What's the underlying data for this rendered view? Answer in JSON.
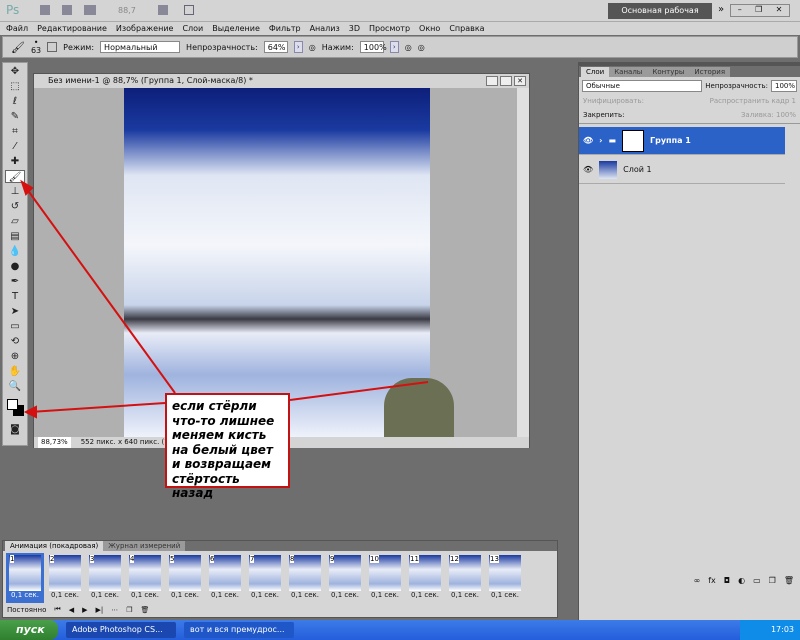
{
  "appbar": {
    "logo": "Ps",
    "zoom": "88,7",
    "workspace": "Основная рабочая среда"
  },
  "menu": [
    "Файл",
    "Редактирование",
    "Изображение",
    "Слои",
    "Выделение",
    "Фильтр",
    "Анализ",
    "3D",
    "Просмотр",
    "Окно",
    "Справка"
  ],
  "options": {
    "brush_size": "63",
    "mode_label": "Режим:",
    "mode_value": "Нормальный",
    "opacity_label": "Непрозрачность:",
    "opacity_value": "64%",
    "flow_label": "Нажим:",
    "flow_value": "100%"
  },
  "document": {
    "title": "Без имени-1 @ 88,7% (Группа 1, Слой-маска/8) *",
    "zoom": "88,73%",
    "info": "552 пикс. x 640 пикс. (72 р"
  },
  "annotation": "если стёрли что-то лишнее меняем кисть на белый цвет и возвращаем стёртость назад",
  "layers_panel": {
    "tabs": [
      "Слои",
      "Каналы",
      "Контуры",
      "История"
    ],
    "blend_mode": "Обычные",
    "opacity_label": "Непрозрачность:",
    "opacity_value": "100%",
    "unify_label": "Унифицировать:",
    "propagate_label": "Распространить кадр 1",
    "lock_label": "Закрепить:",
    "fill_label": "Заливка:",
    "fill_value": "100%",
    "layers": [
      {
        "name": "Группа 1",
        "selected": true
      },
      {
        "name": "Слой 1",
        "selected": false
      }
    ]
  },
  "animation": {
    "tabs": [
      "Анимация (покадровая)",
      "Журнал измерений"
    ],
    "frames": [
      {
        "n": "1",
        "delay": "0,1 сек."
      },
      {
        "n": "2",
        "delay": "0,1 сек."
      },
      {
        "n": "3",
        "delay": "0,1 сек."
      },
      {
        "n": "4",
        "delay": "0,1 сек."
      },
      {
        "n": "5",
        "delay": "0,1 сек."
      },
      {
        "n": "6",
        "delay": "0,1 сек."
      },
      {
        "n": "7",
        "delay": "0,1 сек."
      },
      {
        "n": "8",
        "delay": "0,1 сек."
      },
      {
        "n": "9",
        "delay": "0,1 сек."
      },
      {
        "n": "10",
        "delay": "0,1 сек."
      },
      {
        "n": "11",
        "delay": "0,1 сек."
      },
      {
        "n": "12",
        "delay": "0,1 сек."
      },
      {
        "n": "13",
        "delay": "0,1 сек."
      }
    ],
    "loop": "Постоянно"
  },
  "taskbar": {
    "start": "пуск",
    "tasks": [
      "Adobe Photoshop CS...",
      "вот и вся премудрос..."
    ],
    "clock": "17:03"
  }
}
